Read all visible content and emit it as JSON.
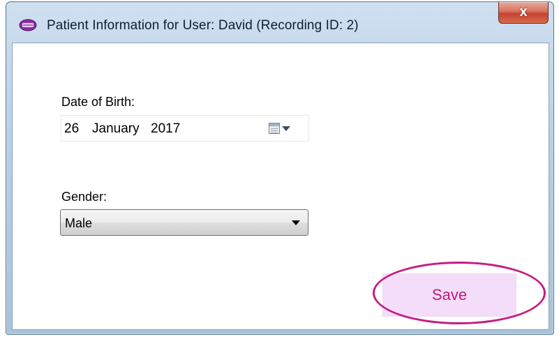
{
  "window": {
    "title": "Patient Information for User: David (Recording ID: 2)",
    "app_icon": "app-icon",
    "close_label": "x"
  },
  "form": {
    "dob_label": "Date of Birth:",
    "dob": {
      "day": "26",
      "month": "January",
      "year": "2017"
    },
    "gender_label": "Gender:",
    "gender_value": "Male"
  },
  "actions": {
    "save_label": "Save"
  },
  "colors": {
    "highlight": "#c41d83",
    "save_bg": "#f4ddf8",
    "save_text": "#c0187d"
  }
}
